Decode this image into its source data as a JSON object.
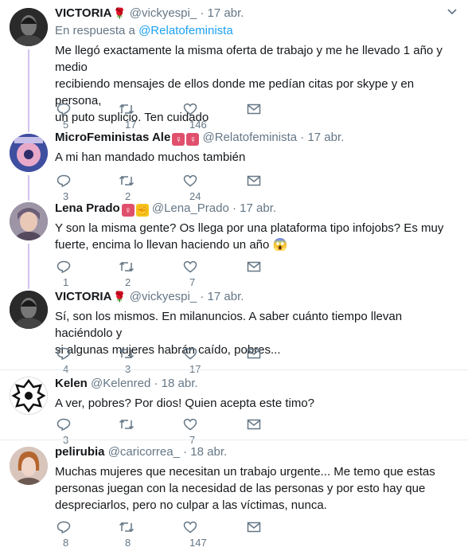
{
  "colors": {
    "accent": "#1da1f2",
    "muted": "#657786",
    "thread": "#d1c4f0"
  },
  "tweets": [
    {
      "name": "VICTORIA",
      "name_emoji": "🌹",
      "handle": "@vickyespi_",
      "dot": "·",
      "date": "17 abr.",
      "reply_prefix": "En respuesta a",
      "reply_to": "@Relatofeminista",
      "lines": [
        "Me llegó exactamente la misma oferta de trabajo y me he llevado 1 año y medio",
        "recibiendo mensajes de ellos donde me pedían citas por skype y en persona,",
        "un puto suplicio. Ten cuidado"
      ],
      "replies": "5",
      "retweets": "17",
      "likes": "146"
    },
    {
      "name": "MicroFeministas Ale",
      "badges": [
        "♀",
        "♀"
      ],
      "handle": "@Relatofeminista",
      "dot": "·",
      "date": "17 abr.",
      "lines": [
        "A mi han mandado muchos también"
      ],
      "replies": "3",
      "retweets": "2",
      "likes": "24"
    },
    {
      "name": "Lena Prado",
      "badges": [
        "♀",
        "✊"
      ],
      "handle": "@Lena_Prado",
      "dot": "·",
      "date": "17 abr.",
      "lines": [
        "Y son la misma gente? Os llega por una plataforma tipo infojobs? Es muy",
        "fuerte, encima lo llevan haciendo un año 😱"
      ],
      "replies": "1",
      "retweets": "2",
      "likes": "7"
    },
    {
      "name": "VICTORIA",
      "name_emoji": "🌹",
      "handle": "@vickyespi_",
      "dot": "·",
      "date": "17 abr.",
      "lines": [
        "Sí, son los mismos. En milanuncios. A saber cuánto tiempo llevan haciéndolo y",
        "si algunas mujeres habrán caído, pobres..."
      ],
      "replies": "4",
      "retweets": "3",
      "likes": "17"
    },
    {
      "name": "Kelen",
      "handle": "@Kelenred",
      "dot": "·",
      "date": "18 abr.",
      "lines": [
        "A ver, pobres? Por dios! Quien acepta este timo?"
      ],
      "replies": "3",
      "retweets": "",
      "likes": "7"
    },
    {
      "name": "pelirubia",
      "handle": "@caricorrea_",
      "dot": "·",
      "date": "18 abr.",
      "lines": [
        "Muchas mujeres que necesitan un trabajo urgente... Me temo que estas",
        "personas juegan con la necesidad de las personas y por esto hay que",
        "despreciarlos, pero no culpar a las víctimas, nunca."
      ],
      "replies": "8",
      "retweets": "8",
      "likes": "147"
    }
  ]
}
